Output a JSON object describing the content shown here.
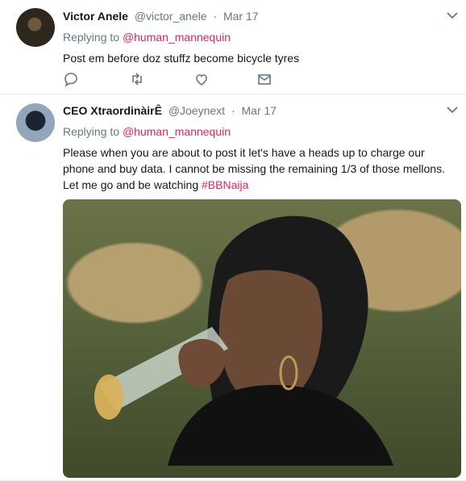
{
  "tweets": [
    {
      "display_name": "Victor Anele",
      "handle": "@victor_anele",
      "date": "Mar 17",
      "replying_to_label": "Replying to",
      "replying_to_handle": "@human_mannequin",
      "text": "Post em before doz stuffz become bicycle tyres"
    },
    {
      "display_name": "CEO XtraordinàirÊ",
      "handle": "@Joeynext",
      "date": "Mar 17",
      "replying_to_label": "Replying to",
      "replying_to_handle": "@human_mannequin",
      "text_main": "Please when you are about to post it let's have a heads up to charge our phone and buy data. I cannot be missing the remaining 1/3 of those mellons. Let me go and be watching",
      "hashtag": "#BBNaija"
    }
  ],
  "icons": {
    "reply": "reply-icon",
    "retweet": "retweet-icon",
    "like": "heart-icon",
    "direct_message": "mail-icon",
    "menu": "chevron-down-icon"
  },
  "colors": {
    "text": "#14171a",
    "secondary": "#657786",
    "link": "#e0245e",
    "border": "#e6ecf0"
  }
}
